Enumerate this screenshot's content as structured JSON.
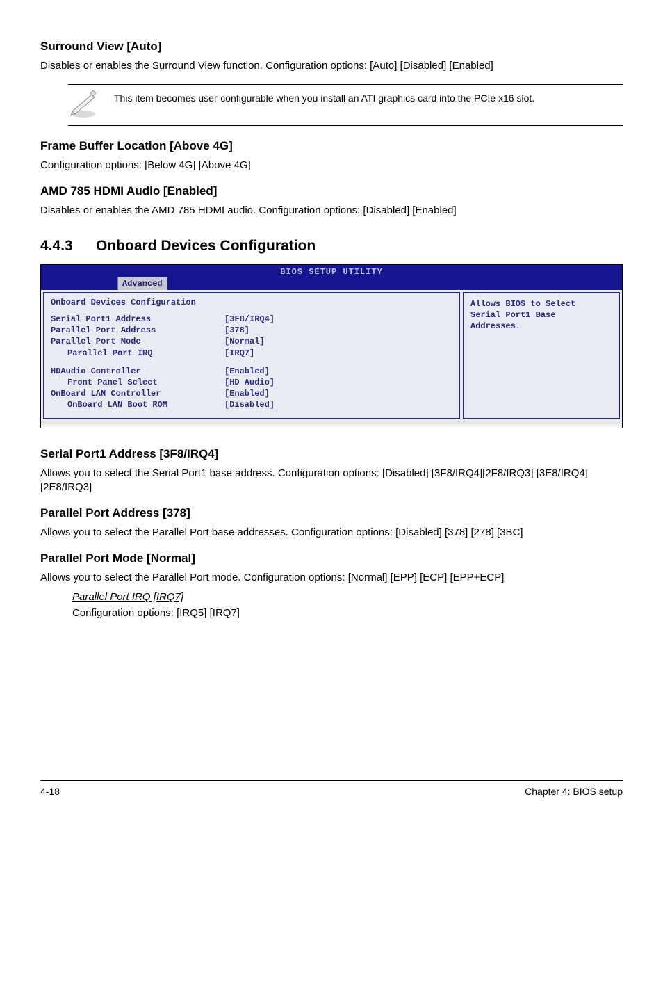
{
  "sec1": {
    "title": "Surround View [Auto]",
    "body": "Disables or enables the Surround View function. Configuration options: [Auto] [Disabled] [Enabled]"
  },
  "note": {
    "text": "This item becomes user-configurable when you install an ATI graphics card into the PCIe x16 slot."
  },
  "sec2": {
    "title": "Frame Buffer Location [Above 4G]",
    "body": "Configuration options: [Below 4G] [Above 4G]"
  },
  "sec3": {
    "title": "AMD 785 HDMI Audio [Enabled]",
    "body": "Disables or enables the AMD 785 HDMI audio. Configuration options: [Disabled] [Enabled]"
  },
  "main": {
    "num": "4.4.3",
    "title": "Onboard Devices Configuration"
  },
  "bios": {
    "util_title": "BIOS SETUP UTILITY",
    "tab": "Advanced",
    "panel_title": "Onboard Devices Configuration",
    "help_line1": "Allows BIOS to Select",
    "help_line2": "Serial Port1 Base",
    "help_line3": "Addresses.",
    "rows": [
      {
        "label": "Serial Port1 Address",
        "value": "[3F8/IRQ4]",
        "indent": false
      },
      {
        "label": "Parallel Port Address",
        "value": "[378]",
        "indent": false
      },
      {
        "label": "Parallel Port Mode",
        "value": "[Normal]",
        "indent": false
      },
      {
        "label": "Parallel Port IRQ",
        "value": "[IRQ7]",
        "indent": true
      }
    ],
    "rows2": [
      {
        "label": "HDAudio Controller",
        "value": "[Enabled]",
        "indent": false
      },
      {
        "label": "Front Panel Select",
        "value": "[HD Audio]",
        "indent": true
      },
      {
        "label": "OnBoard LAN Controller",
        "value": "[Enabled]",
        "indent": false
      },
      {
        "label": "OnBoard LAN Boot ROM",
        "value": "[Disabled]",
        "indent": true
      }
    ]
  },
  "sec4": {
    "title": "Serial Port1 Address [3F8/IRQ4]",
    "body": "Allows you to select the Serial Port1 base address. Configuration options: [Disabled] [3F8/IRQ4][2F8/IRQ3] [3E8/IRQ4] [2E8/IRQ3]"
  },
  "sec5": {
    "title": "Parallel Port Address [378]",
    "body": "Allows you to select the Parallel Port base addresses. Configuration options: [Disabled] [378] [278] [3BC]"
  },
  "sec6": {
    "title": "Parallel Port Mode [Normal]",
    "body": "Allows you to select the Parallel Port  mode. Configuration options: [Normal] [EPP] [ECP] [EPP+ECP]",
    "sub_title": "Parallel Port IRQ [IRQ7]",
    "sub_body": "Configuration options: [IRQ5] [IRQ7]"
  },
  "footer": {
    "left": "4-18",
    "right": "Chapter 4: BIOS setup"
  }
}
